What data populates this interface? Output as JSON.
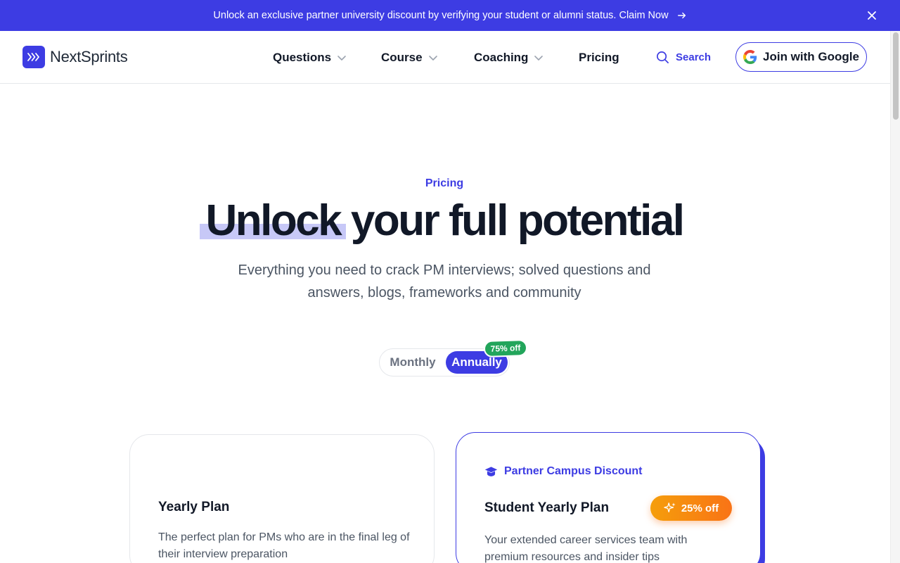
{
  "banner": {
    "text": "Unlock an exclusive partner university discount by verifying your student or alumni status. Claim Now",
    "arrow_icon": "arrow-right-icon",
    "close_icon": "close-icon",
    "color": "#3d3ce3"
  },
  "header": {
    "logo_text": "NextSprints",
    "nav": {
      "questions": "Questions",
      "course": "Course",
      "coaching": "Coaching",
      "pricing": "Pricing"
    },
    "search_label": "Search",
    "google_button_label": "Join with Google"
  },
  "hero": {
    "eyebrow": "Pricing",
    "headline_highlight": "Unlock",
    "headline_rest": "your full potential",
    "subhead": "Everything you need to crack PM interviews; solved questions and answers, blogs, frameworks and community"
  },
  "billing_toggle": {
    "monthly": "Monthly",
    "annually": "Annually",
    "selected": "Annually",
    "discount_badge": "75% off"
  },
  "plans": [
    {
      "title": "Yearly Plan",
      "description": "The perfect plan for PMs who are in the final leg of their interview preparation"
    },
    {
      "tag": "Partner Campus Discount",
      "title": "Student Yearly Plan",
      "badge": "25% off",
      "description": "Your extended career services team with premium resources and insider tips"
    }
  ],
  "colors": {
    "accent": "#3d3ce3",
    "success": "#22a55b",
    "badge_orange": "#f97316"
  }
}
